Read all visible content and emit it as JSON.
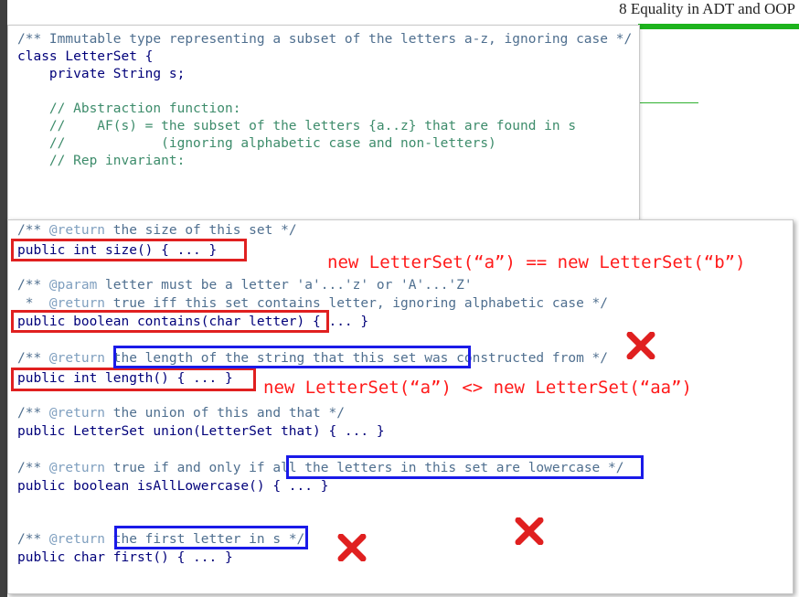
{
  "slide_title": "8 Equality in ADT and OOP",
  "top_code": [
    "/** Immutable type representing a subset of the letters a-z, ignoring case */",
    "class LetterSet {",
    "    private String s;",
    "",
    "    // Abstraction function:",
    "    //    AF(s) = the subset of the letters {a..z} that are found in s",
    "    //            (ignoring alphabetic case and non-letters)",
    "    // Rep invariant:"
  ],
  "methods": {
    "size_doc_tag": "@return",
    "size_doc_text": " the size of this set */",
    "size_sig": "public int size() { ... }",
    "contains_doc1_tag": "@param",
    "contains_doc1_text": " letter must be a letter 'a'...'z' or 'A'...'Z'",
    "contains_doc2_tag": "@return",
    "contains_doc2_text": " true iff this set contains letter, ignoring alphabetic case */",
    "contains_sig": "public boolean contains(char letter) { ... }",
    "length_doc_tag": "@return",
    "length_doc_text": " the length of the string that this set was constructed from */",
    "length_sig": "public int length() { ... }",
    "union_doc_tag": "@return",
    "union_doc_text": " the union of this and that */",
    "union_sig": "public LetterSet union(LetterSet that) { ... }",
    "lower_doc_tag": "@return",
    "lower_doc_text": " true if and only if all the letters in this set are lowercase */",
    "lower_sig": "public boolean isAllLowercase() { ... }",
    "first_doc_tag": "@return",
    "first_doc_text": " the first letter in s */",
    "first_sig": "public char first() { ... }"
  },
  "annotations": {
    "equal_example": "new LetterSet(“a”) == new LetterSet(“b”)",
    "notequal_example": "new LetterSet(“a”) <> new LetterSet(“aa”)"
  },
  "colors": {
    "highlight_red": "#e02020",
    "highlight_blue": "#1a1ae8",
    "accent_green": "#1db31d"
  },
  "icons": [
    "x-mark-icon"
  ]
}
